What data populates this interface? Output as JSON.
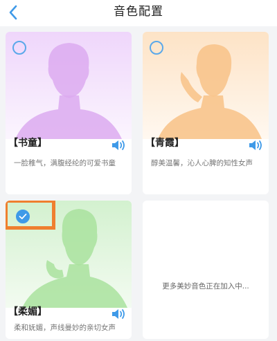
{
  "header": {
    "title": "音色配置",
    "back_icon": "chevron-left-icon",
    "accent": "#3f9ae8"
  },
  "voices": [
    {
      "name": "【书童】",
      "description": "一脸稚气，满腹经纶的可爱书童",
      "selected": false,
      "tint": "#e6c9f5"
    },
    {
      "name": "【青霞】",
      "description": "醇美温馨，沁人心脾的知性女声",
      "selected": false,
      "tint": "#fde0bf"
    },
    {
      "name": "【柔媚】",
      "description": "柔和妩媚，声线曼妙的亲切女声",
      "selected": true,
      "tint": "#cfeec9"
    }
  ],
  "placeholder_card": {
    "text": "更多美妙音色正在加入中..."
  },
  "icons": {
    "play": "speaker-icon",
    "check": "check-icon"
  },
  "colors": {
    "highlight_box": "#ef7f2f",
    "radio": "#5aa8ea"
  }
}
